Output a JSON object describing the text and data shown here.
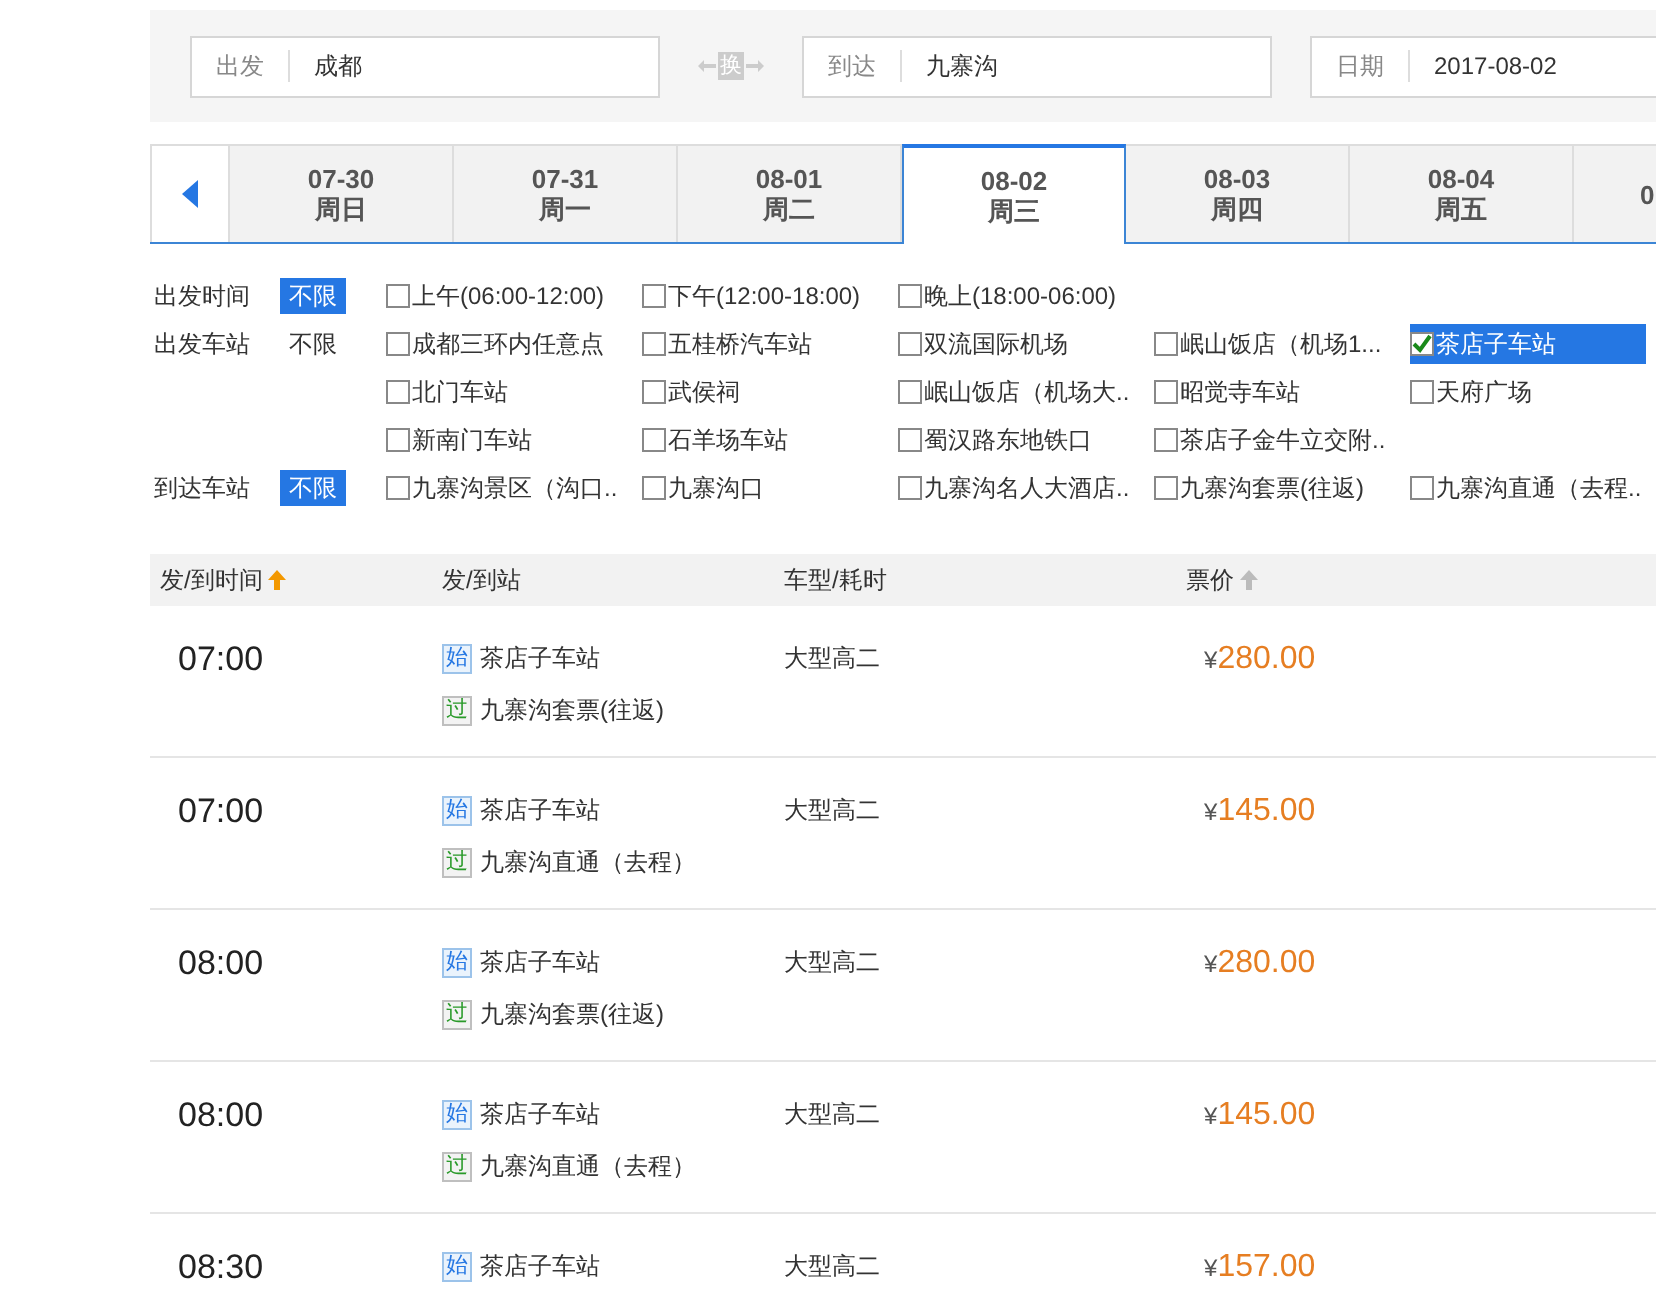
{
  "search": {
    "from": {
      "label": "出发",
      "value": "成都"
    },
    "swap": {
      "label": "换"
    },
    "to": {
      "label": "到达",
      "value": "九寨沟"
    },
    "date": {
      "label": "日期",
      "value": "2017-08-02"
    }
  },
  "date_tabs": [
    {
      "date": "07-30",
      "day": "周日",
      "selected": false
    },
    {
      "date": "07-31",
      "day": "周一",
      "selected": false
    },
    {
      "date": "08-01",
      "day": "周二",
      "selected": false
    },
    {
      "date": "08-02",
      "day": "周三",
      "selected": true
    },
    {
      "date": "08-03",
      "day": "周四",
      "selected": false
    },
    {
      "date": "08-04",
      "day": "周五",
      "selected": false
    },
    {
      "date": "0",
      "selected": false
    }
  ],
  "filters": [
    {
      "label": "出发时间",
      "any": {
        "label": "不限",
        "selected": true
      },
      "options": [
        {
          "label": "上午(06:00-12:00)",
          "checked": false
        },
        {
          "label": "下午(12:00-18:00)",
          "checked": false
        },
        {
          "label": "晚上(18:00-06:00)",
          "checked": false
        }
      ]
    },
    {
      "label": "出发车站",
      "any": {
        "label": "不限",
        "selected": false
      },
      "options": [
        {
          "label": "成都三环内任意点",
          "checked": false
        },
        {
          "label": "五桂桥汽车站",
          "checked": false
        },
        {
          "label": "双流国际机场",
          "checked": false
        },
        {
          "label": "岷山饭店（机场1...",
          "checked": false
        },
        {
          "label": "茶店子车站",
          "checked": true
        },
        {
          "label": "北门车站",
          "checked": false
        },
        {
          "label": "武侯祠",
          "checked": false
        },
        {
          "label": "岷山饭店（机场大..",
          "checked": false
        },
        {
          "label": "昭觉寺车站",
          "checked": false
        },
        {
          "label": "天府广场",
          "checked": false
        },
        {
          "label": "新南门车站",
          "checked": false
        },
        {
          "label": "石羊场车站",
          "checked": false
        },
        {
          "label": "蜀汉路东地铁口",
          "checked": false
        },
        {
          "label": "茶店子金牛立交附..",
          "checked": false
        }
      ]
    },
    {
      "label": "到达车站",
      "any": {
        "label": "不限",
        "selected": true
      },
      "options": [
        {
          "label": "九寨沟景区（沟口..",
          "checked": false
        },
        {
          "label": "九寨沟口",
          "checked": false
        },
        {
          "label": "九寨沟名人大酒店..",
          "checked": false
        },
        {
          "label": "九寨沟套票(往返)",
          "checked": false
        },
        {
          "label": "九寨沟直通（去程..",
          "checked": false
        }
      ]
    }
  ],
  "table": {
    "columns": [
      {
        "label": "发/到时间",
        "sorted": true
      },
      {
        "label": "发/到站"
      },
      {
        "label": "车型/耗时"
      },
      {
        "label": "票价",
        "sorted": false
      }
    ],
    "rows": [
      {
        "time": "07:00",
        "start_badge": "始",
        "start": "茶店子车站",
        "pass_badge": "过",
        "pass": "九寨沟套票(往返)",
        "type": "大型高二",
        "currency": "¥",
        "price": "280.00"
      },
      {
        "time": "07:00",
        "start_badge": "始",
        "start": "茶店子车站",
        "pass_badge": "过",
        "pass": "九寨沟直通（去程）",
        "type": "大型高二",
        "currency": "¥",
        "price": "145.00"
      },
      {
        "time": "08:00",
        "start_badge": "始",
        "start": "茶店子车站",
        "pass_badge": "过",
        "pass": "九寨沟套票(往返)",
        "type": "大型高二",
        "currency": "¥",
        "price": "280.00"
      },
      {
        "time": "08:00",
        "start_badge": "始",
        "start": "茶店子车站",
        "pass_badge": "过",
        "pass": "九寨沟直通（去程）",
        "type": "大型高二",
        "currency": "¥",
        "price": "145.00"
      },
      {
        "time": "08:30",
        "start_badge": "始",
        "start": "茶店子车站",
        "type": "大型高二",
        "currency": "¥",
        "price": "157.00"
      }
    ]
  }
}
